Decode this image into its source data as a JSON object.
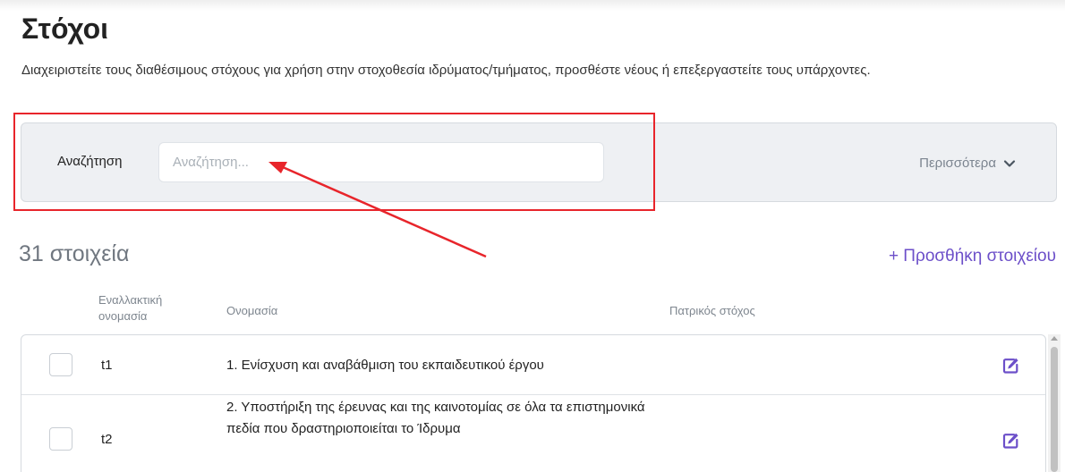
{
  "page": {
    "title": "Στόχοι",
    "description": "Διαχειριστείτε τους διαθέσιμους στόχους για χρήση στην στοχοθεσία ιδρύματος/τμήματος, προσθέστε νέους ή επεξεργαστείτε τους υπάρχοντες."
  },
  "filter": {
    "search_label": "Αναζήτηση",
    "search_placeholder": "Αναζήτηση...",
    "search_value": "",
    "more_label": "Περισσότερα"
  },
  "list": {
    "count_label": "31 στοιχεία",
    "add_label": "+ Προσθήκη στοιχείου",
    "columns": {
      "alt_name_line1": "Εναλλακτική",
      "alt_name_line2": "ονομασία",
      "name": "Ονομασία",
      "parent": "Πατρικός στόχος"
    },
    "rows": [
      {
        "alt_name": "t1",
        "name": "1. Ενίσχυση και αναβάθμιση του εκπαιδευτικού έργου",
        "parent": ""
      },
      {
        "alt_name": "t2",
        "name": "2. Υποστήριξη της έρευνας και της καινοτομίας σε όλα τα επιστημονικά πεδία που δραστηριοποιείται το Ίδρυμα",
        "parent": ""
      }
    ]
  },
  "icons": {
    "more": "chevron-down-icon",
    "edit": "edit-icon"
  },
  "colors": {
    "accent": "#6c4fc9",
    "annotation": "#e8252b",
    "panel_bg": "#eef0f3"
  }
}
